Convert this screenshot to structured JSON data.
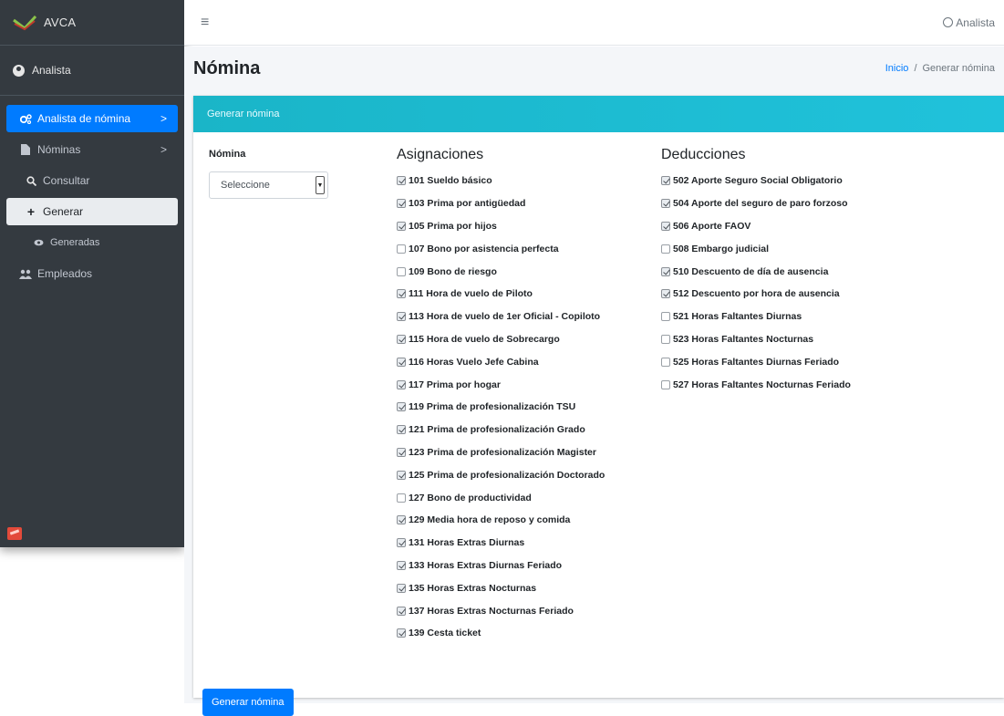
{
  "brand": {
    "name": "AVCA"
  },
  "sidebar": {
    "user": "Analista",
    "items": [
      {
        "label": "Analista de nómina",
        "chevron": ">"
      },
      {
        "label": "Nóminas",
        "chevron": ">"
      },
      {
        "label": "Consultar"
      },
      {
        "label": "Generar"
      },
      {
        "label": "Generadas"
      },
      {
        "label": "Empleados"
      }
    ]
  },
  "topbar": {
    "user": "Analista"
  },
  "page": {
    "title": "Nómina",
    "breadcrumb": {
      "home": "Inicio",
      "sep": "/",
      "current": "Generar nómina"
    }
  },
  "card": {
    "header": "Generar nómina",
    "nomina_label": "Nómina",
    "select_value": "Seleccione",
    "asignaciones_title": "Asignaciones",
    "deducciones_title": "Deducciones",
    "submit": "Generar nómina"
  },
  "asignaciones": [
    {
      "label": "101 Sueldo básico",
      "checked": true
    },
    {
      "label": "103 Prima por antigüedad",
      "checked": true
    },
    {
      "label": "105 Prima por hijos",
      "checked": true
    },
    {
      "label": "107 Bono por asistencia perfecta",
      "checked": false
    },
    {
      "label": "109 Bono de riesgo",
      "checked": false
    },
    {
      "label": "111 Hora de vuelo de Piloto",
      "checked": true
    },
    {
      "label": "113 Hora de vuelo de 1er Oficial - Copiloto",
      "checked": true
    },
    {
      "label": "115 Hora de vuelo de Sobrecargo",
      "checked": true
    },
    {
      "label": "116 Horas Vuelo Jefe Cabina",
      "checked": true
    },
    {
      "label": "117 Prima por hogar",
      "checked": true
    },
    {
      "label": "119 Prima de profesionalización TSU",
      "checked": true
    },
    {
      "label": "121 Prima de profesionalización Grado",
      "checked": true
    },
    {
      "label": "123 Prima de profesionalización Magister",
      "checked": true
    },
    {
      "label": "125 Prima de profesionalización Doctorado",
      "checked": true
    },
    {
      "label": "127 Bono de productividad",
      "checked": false
    },
    {
      "label": "129 Media hora de reposo y comida",
      "checked": true
    },
    {
      "label": "131 Horas Extras Diurnas",
      "checked": true
    },
    {
      "label": "133 Horas Extras Diurnas Feriado",
      "checked": true
    },
    {
      "label": "135 Horas Extras Nocturnas",
      "checked": true
    },
    {
      "label": "137 Horas Extras Nocturnas Feriado",
      "checked": true
    },
    {
      "label": "139 Cesta ticket",
      "checked": true
    }
  ],
  "deducciones": [
    {
      "label": "502 Aporte Seguro Social Obligatorio",
      "checked": true
    },
    {
      "label": "504 Aporte del seguro de paro forzoso",
      "checked": true
    },
    {
      "label": "506 Aporte FAOV",
      "checked": true
    },
    {
      "label": "508 Embargo judicial",
      "checked": false
    },
    {
      "label": "510 Descuento de día de ausencia",
      "checked": true
    },
    {
      "label": "512 Descuento por hora de ausencia",
      "checked": true
    },
    {
      "label": "521 Horas Faltantes Diurnas",
      "checked": false
    },
    {
      "label": "523 Horas Faltantes Nocturnas",
      "checked": false
    },
    {
      "label": "525 Horas Faltantes Diurnas Feriado",
      "checked": false
    },
    {
      "label": "527 Horas Faltantes Nocturnas Feriado",
      "checked": false
    }
  ],
  "colors": {
    "primary": "#007bff",
    "sidebar": "#343a40",
    "header_teal": "#1ab5c8"
  },
  "icons": [
    "brand-logo-icon",
    "user-circle-icon",
    "gears-icon",
    "file-icon",
    "search-icon",
    "plus-icon",
    "eye-icon",
    "users-icon",
    "hamburger-icon",
    "plugin-icon"
  ]
}
